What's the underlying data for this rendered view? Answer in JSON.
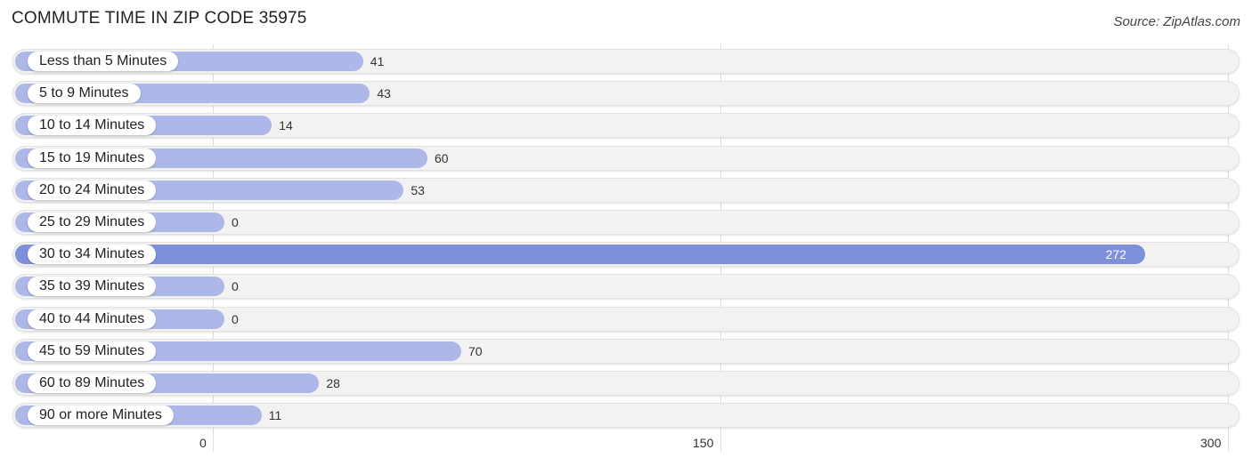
{
  "title": "COMMUTE TIME IN ZIP CODE 35975",
  "source": "Source: ZipAtlas.com",
  "chart_data": {
    "type": "bar",
    "orientation": "horizontal",
    "title": "COMMUTE TIME IN ZIP CODE 35975",
    "categories": [
      "Less than 5 Minutes",
      "5 to 9 Minutes",
      "10 to 14 Minutes",
      "15 to 19 Minutes",
      "20 to 24 Minutes",
      "25 to 29 Minutes",
      "30 to 34 Minutes",
      "35 to 39 Minutes",
      "40 to 44 Minutes",
      "45 to 59 Minutes",
      "60 to 89 Minutes",
      "90 or more Minutes"
    ],
    "values": [
      41,
      43,
      14,
      60,
      53,
      0,
      272,
      0,
      0,
      70,
      28,
      11
    ],
    "xlim": [
      0,
      300
    ],
    "xticks": [
      "0",
      "150",
      "300"
    ],
    "xtick_values": [
      0,
      150,
      300
    ],
    "grid": true,
    "highlight_color": "#7e90dc",
    "bar_color": "#aeb8e8",
    "xlabel": "",
    "ylabel": ""
  }
}
